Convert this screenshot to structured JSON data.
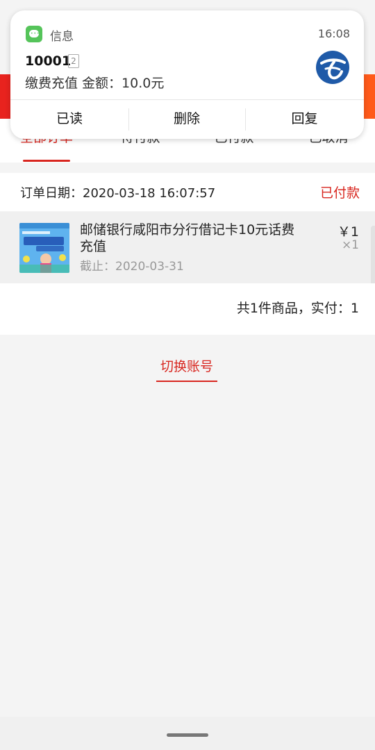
{
  "notification": {
    "app_name": "信息",
    "time": "16:08",
    "sender": "10001",
    "sim_slot": "2",
    "message": "缴费充值 金额：10.0元",
    "actions": [
      "已读",
      "删除",
      "回复"
    ],
    "app_icon": "message-bubble-icon",
    "sender_logo": "china-telecom-logo"
  },
  "tabs": [
    {
      "label": "全部订单",
      "active": true
    },
    {
      "label": "待付款",
      "active": false
    },
    {
      "label": "已付款",
      "active": false
    },
    {
      "label": "已取消",
      "active": false
    }
  ],
  "order": {
    "date_label": "订单日期：2020-03-18 16:07:57",
    "status": "已付款",
    "item": {
      "title": "邮储银行咸阳市分行借记卡10元话费充值",
      "deadline": "截止：2020-03-31",
      "price": "￥1",
      "quantity": "×1"
    },
    "summary": "共1件商品，实付：1"
  },
  "switch_account_label": "切换账号",
  "colors": {
    "accent_red": "#d8261f",
    "header_red": "#e8231e",
    "message_green": "#55c45a",
    "telecom_blue": "#1f5aa8"
  }
}
